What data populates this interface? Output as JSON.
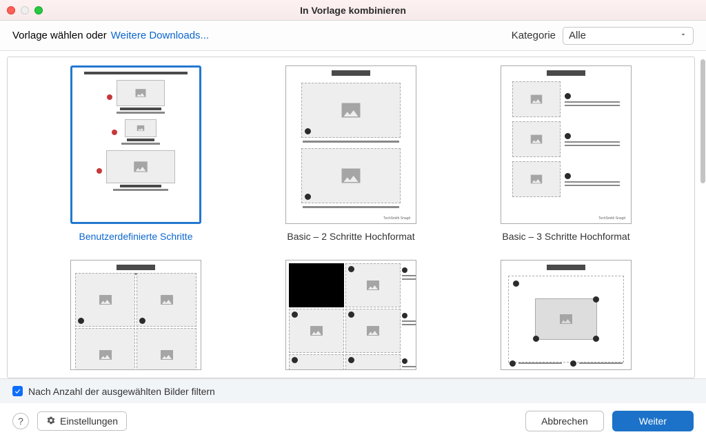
{
  "window": {
    "title": "In Vorlage kombinieren"
  },
  "header": {
    "choose_label": "Vorlage wählen oder",
    "downloads_link": "Weitere Downloads...",
    "category_label": "Kategorie",
    "category_value": "Alle"
  },
  "templates": [
    {
      "label": "Benutzerdefinierte Schritte",
      "selected": true
    },
    {
      "label": "Basic – 2 Schritte Hochformat",
      "selected": false
    },
    {
      "label": "Basic – 3 Schritte Hochformat",
      "selected": false
    }
  ],
  "filter": {
    "checked": true,
    "label": "Nach Anzahl der ausgewählten Bilder filtern"
  },
  "footer": {
    "help": "?",
    "settings": "Einstellungen",
    "cancel": "Abbrechen",
    "next": "Weiter"
  },
  "thumb_footer": "TechSmith Snagit"
}
